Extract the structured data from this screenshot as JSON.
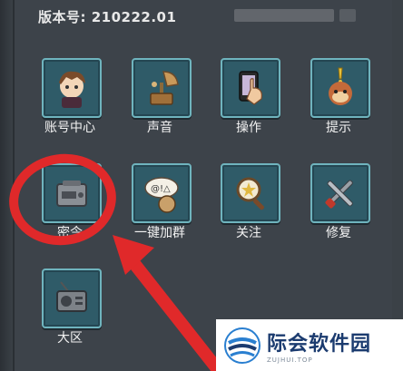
{
  "header": {
    "version_label": "版本号: 210222.01"
  },
  "menu": {
    "account": "账号中心",
    "sound": "声音",
    "controls": "操作",
    "tips": "提示",
    "password": "密令",
    "join_group": "一键加群",
    "follow": "关注",
    "repair": "修复",
    "region": "大区"
  },
  "watermark": {
    "main": "际会软件园",
    "sub": "ZUJHUI.TOP"
  },
  "colors": {
    "tile_bg": "#2f5b68",
    "tile_border": "#6fb4be",
    "annotation_red": "#e0292a"
  }
}
